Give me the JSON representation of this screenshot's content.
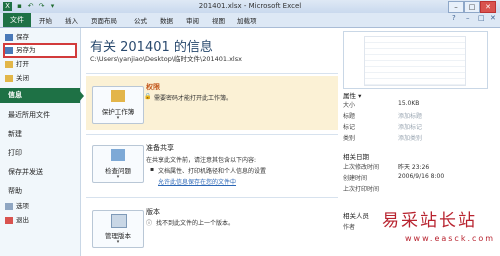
{
  "window": {
    "title": "201401.xlsx - Microsoft Excel"
  },
  "ribbon": {
    "file_tab": "文件",
    "tabs": [
      "开始",
      "插入",
      "页面布局",
      "公式",
      "数据",
      "审阅",
      "视图",
      "加载项"
    ]
  },
  "nav": {
    "save": "保存",
    "save_as": "另存为",
    "open": "打开",
    "close": "关闭",
    "info": "信息",
    "recent": "最近所用文件",
    "new": "新建",
    "print": "打印",
    "save_send": "保存并发送",
    "help": "帮助",
    "options": "选项",
    "exit": "退出"
  },
  "info": {
    "title": "有关 201401 的信息",
    "path": "C:\\Users\\yanjiao\\Desktop\\临时文件\\201401.xlsx",
    "permissions": {
      "button": "保护工作簿",
      "heading": "权限",
      "text": "需要密码才能打开此工作簿。"
    },
    "prepare": {
      "button": "检查问题",
      "heading": "准备共享",
      "text": "在共享此文件前，请注意其包含以下内容:",
      "bullet": "文档属性、打印机路径和个人信息的设置",
      "link": "允许此信息保存在您的文件中"
    },
    "versions": {
      "button": "管理版本",
      "heading": "版本",
      "text": "找不到此文件的上一个版本。"
    }
  },
  "properties": {
    "heading": "属性 ▾",
    "rows": [
      {
        "label": "大小",
        "value": "15.0KB"
      },
      {
        "label": "标题",
        "value": "添加标题"
      },
      {
        "label": "标记",
        "value": "添加标记"
      },
      {
        "label": "类别",
        "value": "添加类别"
      }
    ],
    "dates_heading": "相关日期",
    "dates": [
      {
        "label": "上次修改时间",
        "value": "昨天 23:26"
      },
      {
        "label": "创建时间",
        "value": "2006/9/16 8:00"
      },
      {
        "label": "上次打印时间",
        "value": ""
      }
    ],
    "people_heading": "相关人员",
    "people": [
      {
        "label": "作者",
        "value": ""
      }
    ]
  },
  "watermark": {
    "cn": "易采站长站",
    "url": "www.easck.com"
  }
}
